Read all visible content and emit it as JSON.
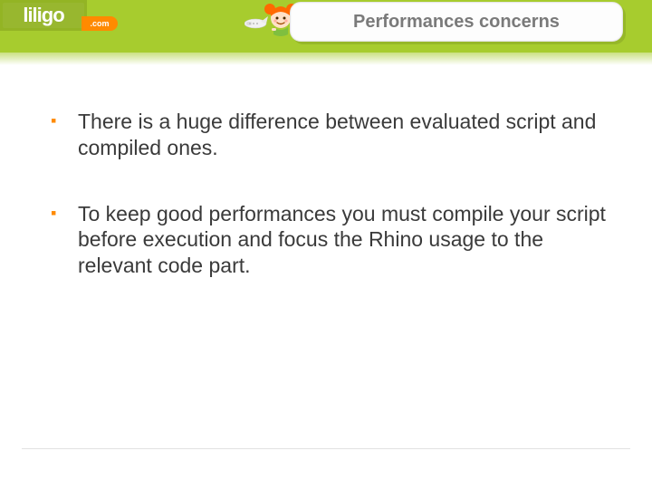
{
  "brand": {
    "name": "liligo",
    "tld": ".com"
  },
  "colors": {
    "header_green": "#a7cc2e",
    "logo_green": "#93b424",
    "accent_orange": "#ff8a00",
    "title_gray": "#7a7a7a",
    "body_text": "#3a3a3a",
    "rule_gray": "#e2e2e2"
  },
  "title": "Performances concerns",
  "bullets": [
    "There is a huge difference between evaluated script and compiled ones.",
    "To keep good performances you must compile your script before execution and focus the Rhino usage to the relevant code part."
  ]
}
